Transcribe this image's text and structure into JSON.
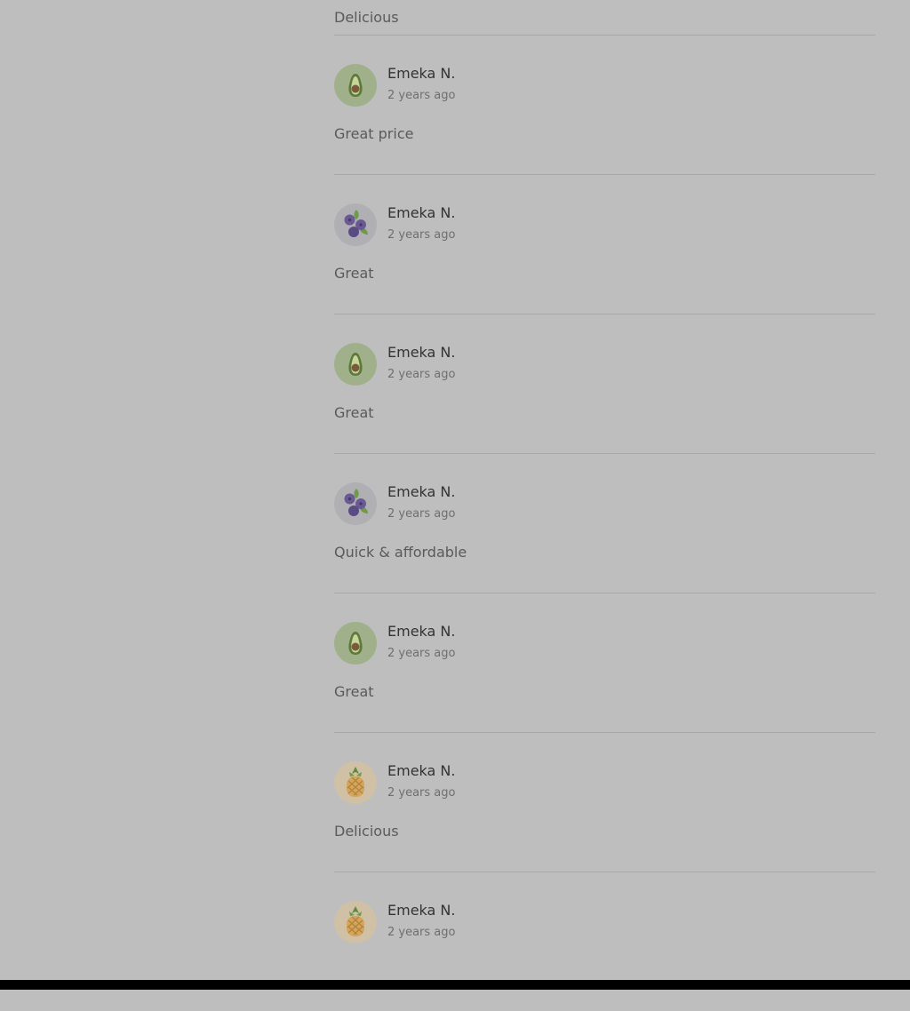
{
  "reviews": {
    "lead_comment": "Delicious",
    "items": [
      {
        "author": "Emeka N.",
        "time": "2 years ago",
        "comment": "Great price",
        "avatar_icon": "avocado-icon"
      },
      {
        "author": "Emeka N.",
        "time": "2 years ago",
        "comment": "Great",
        "avatar_icon": "blueberry-icon"
      },
      {
        "author": "Emeka N.",
        "time": "2 years ago",
        "comment": "Great",
        "avatar_icon": "avocado-icon"
      },
      {
        "author": "Emeka N.",
        "time": "2 years ago",
        "comment": "Quick & affordable",
        "avatar_icon": "blueberry-icon"
      },
      {
        "author": "Emeka N.",
        "time": "2 years ago",
        "comment": "Great",
        "avatar_icon": "avocado-icon"
      },
      {
        "author": "Emeka N.",
        "time": "2 years ago",
        "comment": "Delicious",
        "avatar_icon": "pineapple-icon"
      },
      {
        "author": "Emeka N.",
        "time": "2 years ago",
        "comment": "",
        "avatar_icon": "pineapple-icon"
      }
    ]
  },
  "colors": {
    "overlay_background": "#bebebe",
    "author_text": "#333333",
    "comment_text": "#5a5a5a",
    "time_text": "#6f6f6f",
    "divider": "#a8a8a8",
    "avocado_bg": "#9fb08a",
    "blueberry_bg": "#b0b0b4",
    "pineapple_bg": "#cfc0a6"
  }
}
